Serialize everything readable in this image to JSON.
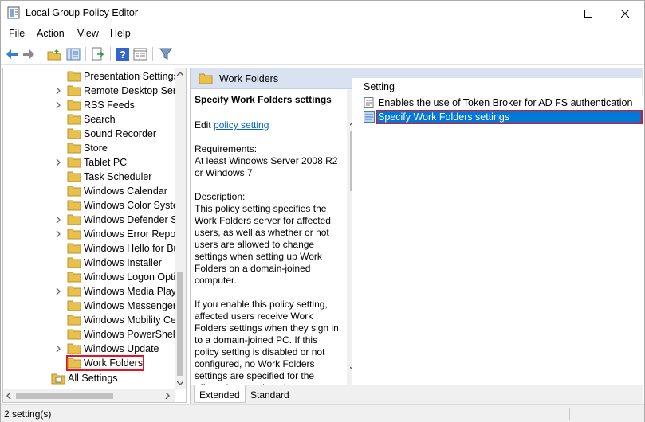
{
  "window": {
    "title": "Local Group Policy Editor",
    "colors": {
      "selection": "#0078d7",
      "highlight_box": "#e81123",
      "header_band": "#d9e2f1",
      "folder": "#e8c04c"
    }
  },
  "menu": [
    "File",
    "Action",
    "View",
    "Help"
  ],
  "tree": {
    "items": [
      {
        "label": "Presentation Settings",
        "chevron": false
      },
      {
        "label": "Remote Desktop Serv",
        "chevron": true
      },
      {
        "label": "RSS Feeds",
        "chevron": true
      },
      {
        "label": "Search",
        "chevron": false
      },
      {
        "label": "Sound Recorder",
        "chevron": false
      },
      {
        "label": "Store",
        "chevron": false
      },
      {
        "label": "Tablet PC",
        "chevron": true
      },
      {
        "label": "Task Scheduler",
        "chevron": false
      },
      {
        "label": "Windows Calendar",
        "chevron": false
      },
      {
        "label": "Windows Color Syste",
        "chevron": false
      },
      {
        "label": "Windows Defender Sr",
        "chevron": true
      },
      {
        "label": "Windows Error Repor",
        "chevron": true
      },
      {
        "label": "Windows Hello for Bu",
        "chevron": false
      },
      {
        "label": "Windows Installer",
        "chevron": false
      },
      {
        "label": "Windows Logon Opti",
        "chevron": false
      },
      {
        "label": "Windows Media Play",
        "chevron": true
      },
      {
        "label": "Windows Messenger",
        "chevron": false
      },
      {
        "label": "Windows Mobility Ce",
        "chevron": false
      },
      {
        "label": "Windows PowerShell",
        "chevron": false
      },
      {
        "label": "Windows Update",
        "chevron": true
      },
      {
        "label": "Work Folders",
        "chevron": false,
        "selected": true
      }
    ],
    "all_settings": "All Settings"
  },
  "right": {
    "header_title": "Work Folders",
    "desc": {
      "title": "Specify Work Folders settings",
      "edit_prefix": "Edit",
      "edit_link": "policy setting",
      "requirements": "Requirements:\nAt least Windows Server 2008 R2\nor Windows 7",
      "description": "Description:\nThis policy setting specifies the\nWork Folders server for affected\nusers, as well as whether or not\nusers are allowed to change\nsettings when setting up Work\nFolders on a domain-joined\ncomputer.",
      "more": "If you enable this policy setting,\naffected users receive Work\nFolders settings when they sign in\nto a domain-joined PC. If this\npolicy setting is disabled or not\nconfigured, no Work Folders\nsettings are specified for the\naffected users, though users can"
    },
    "list": {
      "column": "Setting",
      "rows": [
        {
          "label": "Enables the use of Token Broker for AD FS authentication"
        },
        {
          "label": "Specify Work Folders settings",
          "selected": true
        }
      ]
    },
    "tabs": [
      "Extended",
      "Standard"
    ]
  },
  "status": "2 setting(s)"
}
